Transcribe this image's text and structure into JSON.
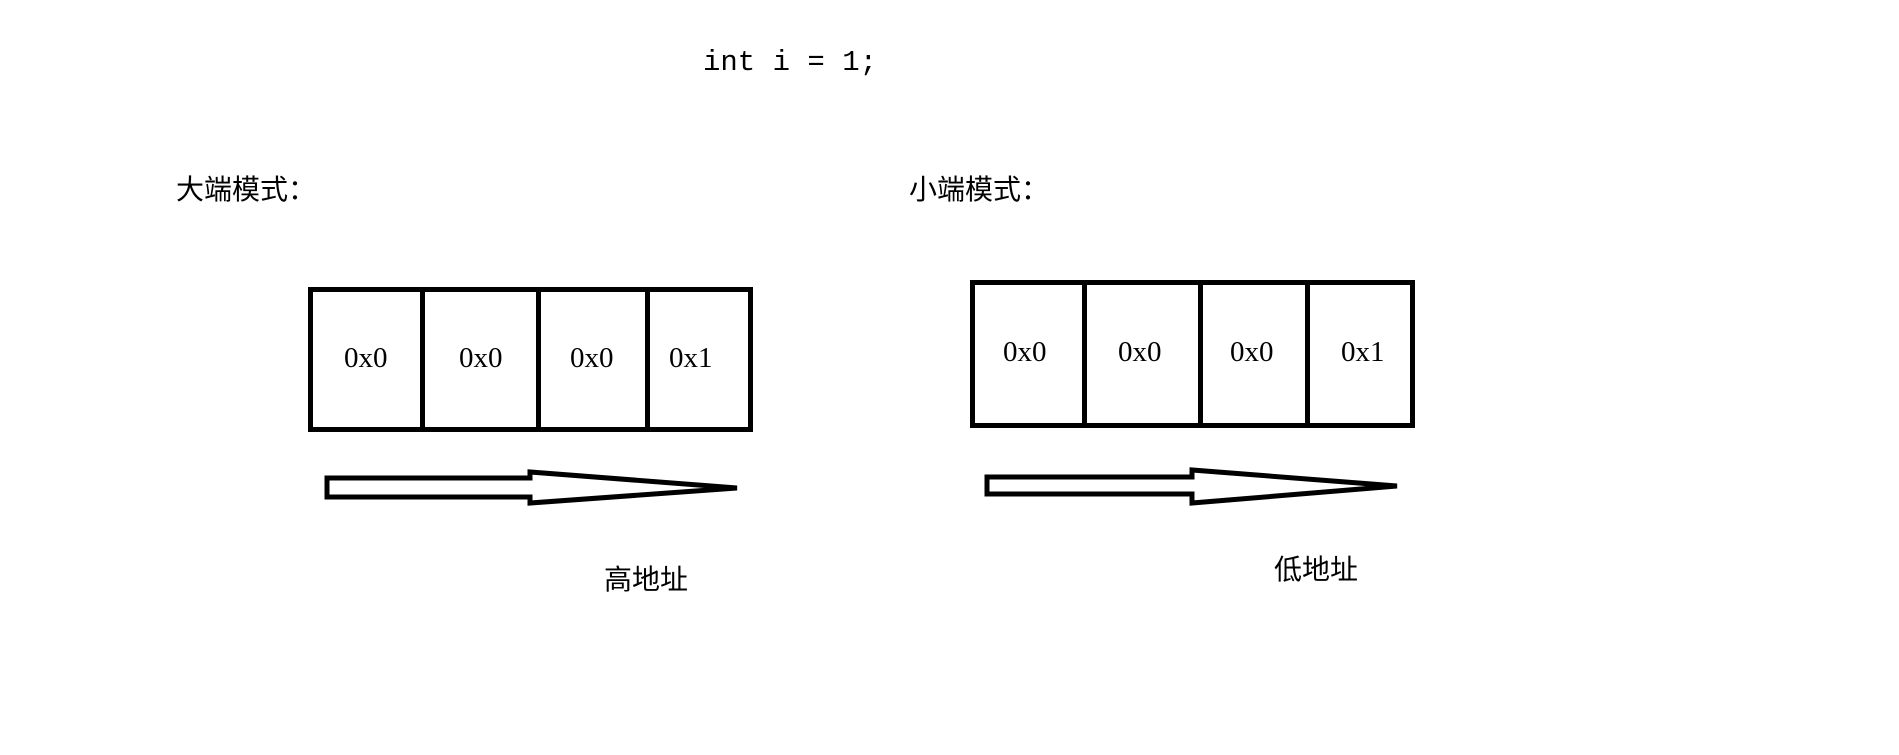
{
  "code_line": "int i = 1;",
  "big_endian": {
    "title": "大端模式：",
    "bytes": [
      "0x0",
      "0x0",
      "0x0",
      "0x1"
    ],
    "direction_label": "高地址"
  },
  "little_endian": {
    "title": "小端模式：",
    "bytes": [
      "0x0",
      "0x0",
      "0x0",
      "0x1"
    ],
    "direction_label": "低地址"
  }
}
